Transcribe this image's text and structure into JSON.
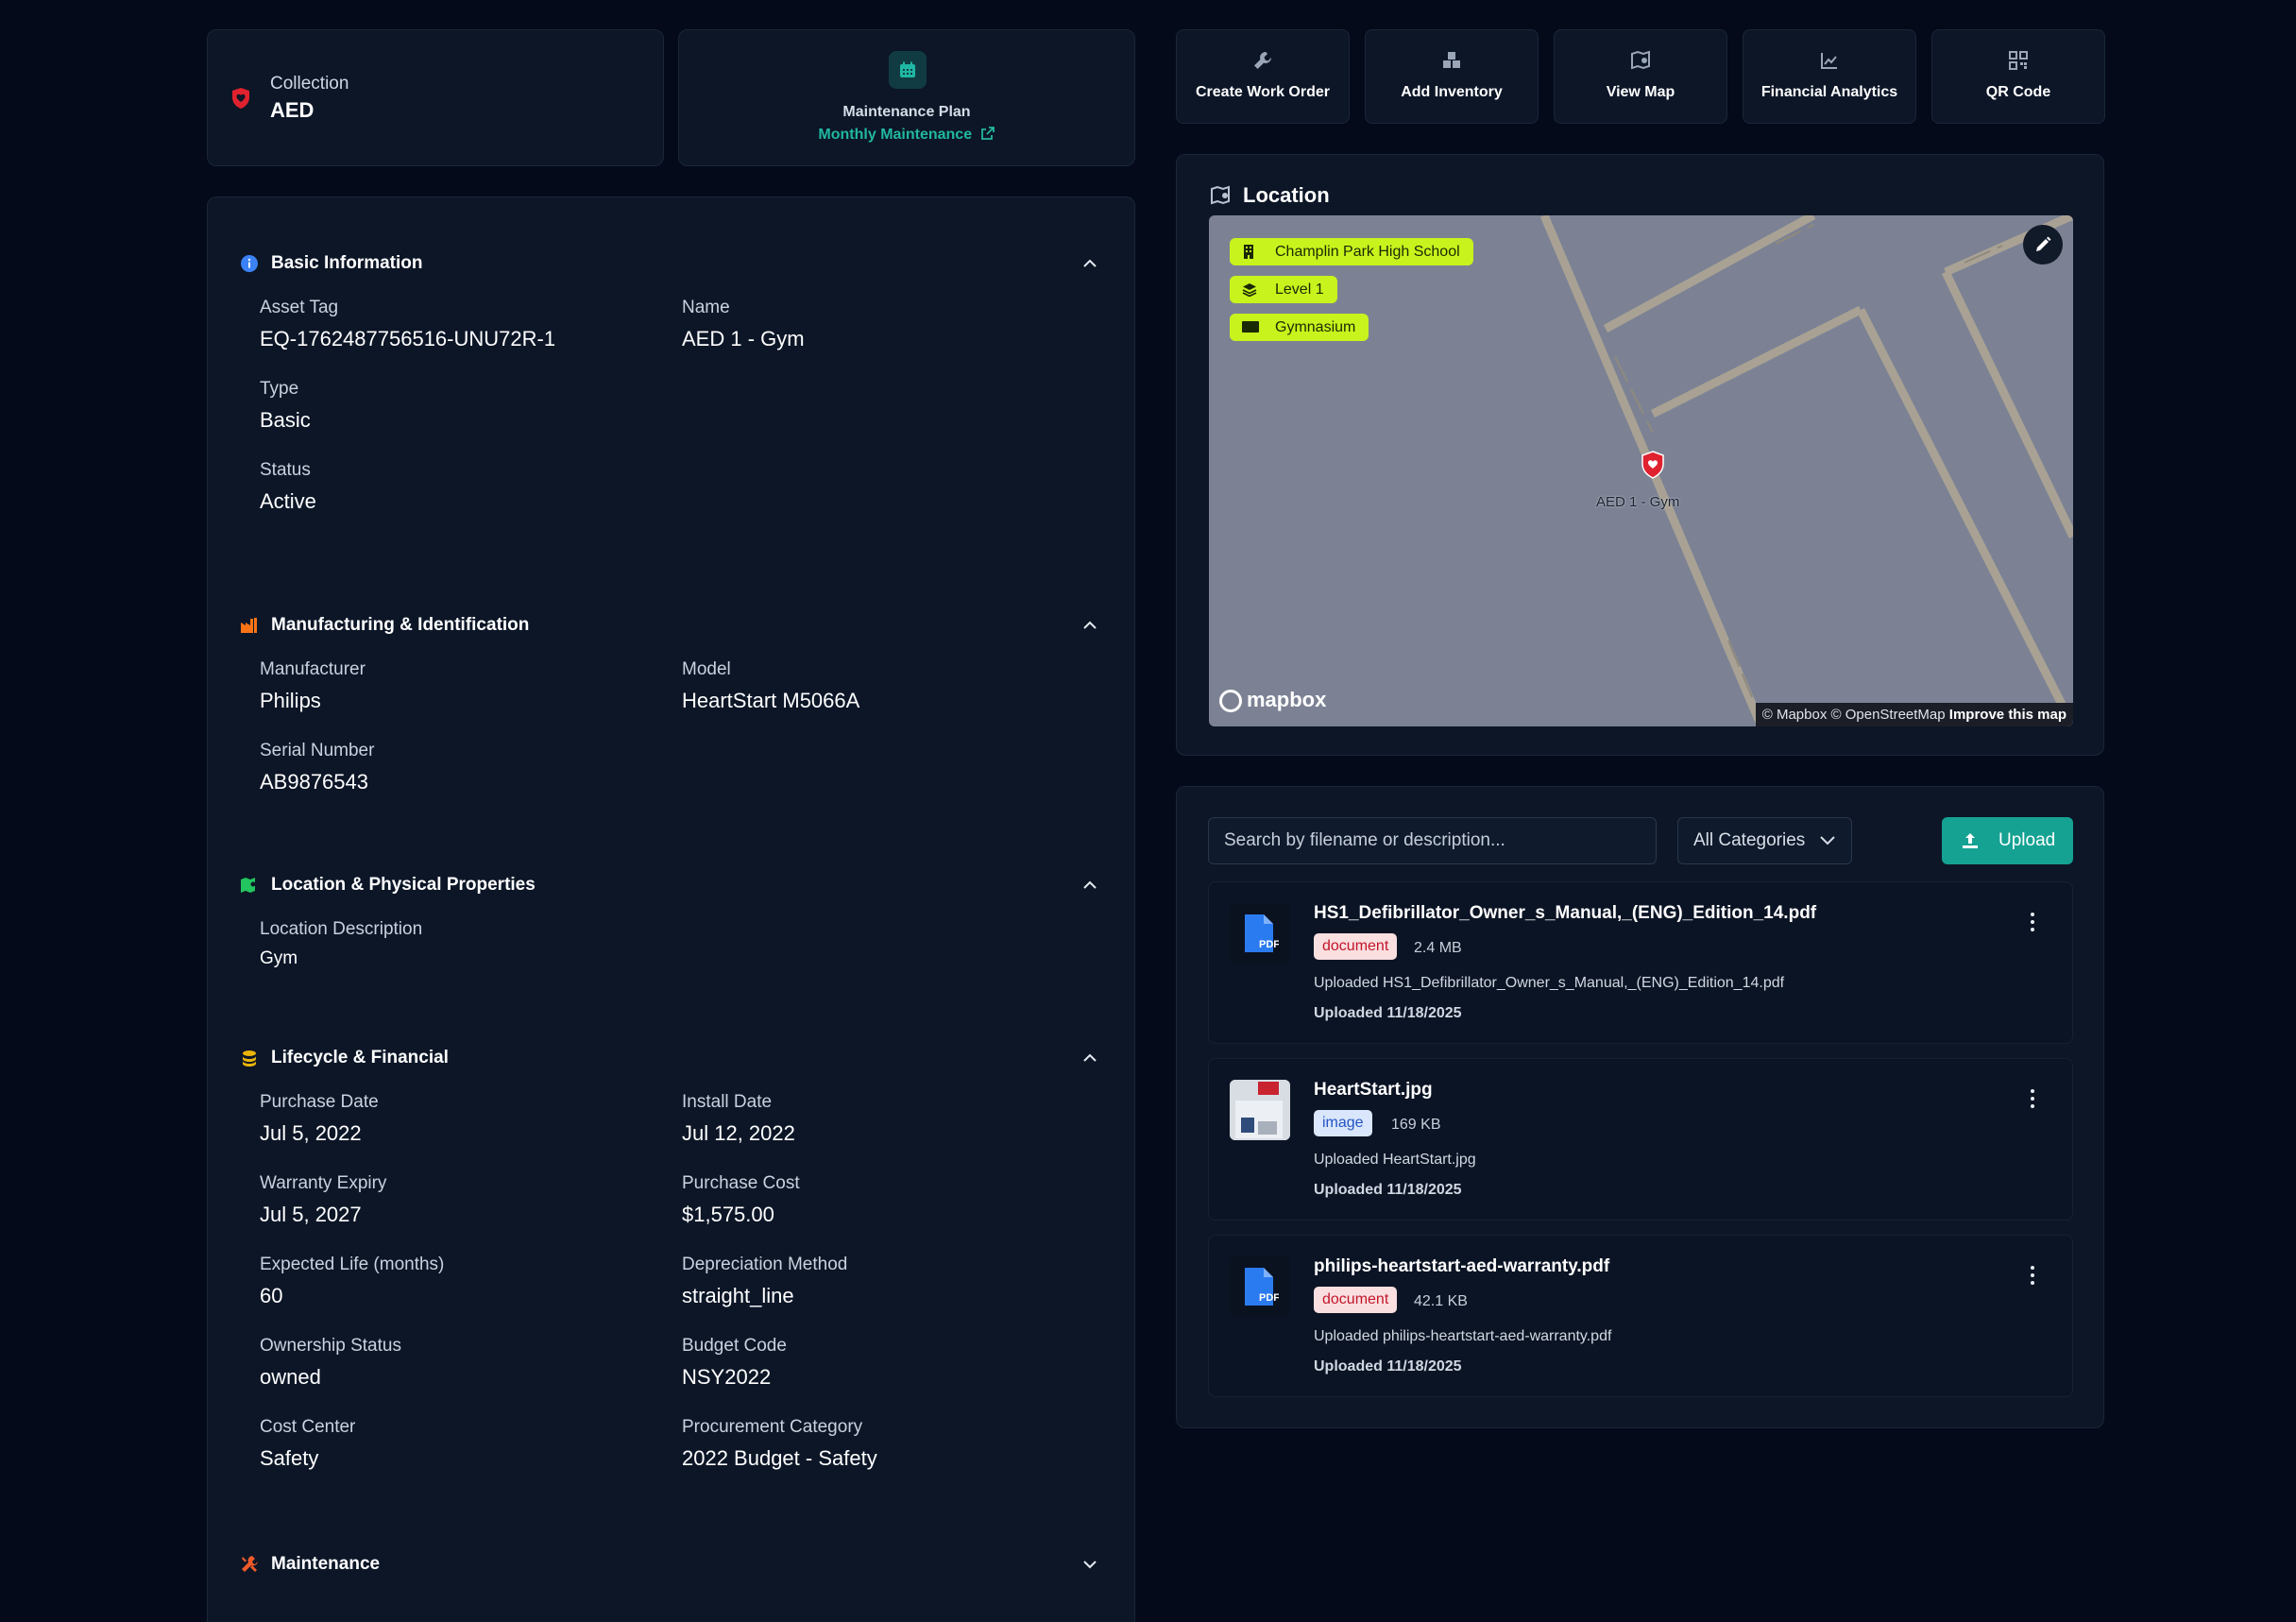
{
  "collection": {
    "label": "Collection",
    "value": "AED"
  },
  "maintenance_plan": {
    "title": "Maintenance Plan",
    "link": "Monthly Maintenance"
  },
  "actions": [
    {
      "label": "Create Work Order",
      "icon": "wrench-icon"
    },
    {
      "label": "Add Inventory",
      "icon": "boxes-icon"
    },
    {
      "label": "View Map",
      "icon": "map-pin-icon"
    },
    {
      "label": "Financial Analytics",
      "icon": "chart-line-icon"
    },
    {
      "label": "QR Code",
      "icon": "qr-code-icon"
    }
  ],
  "sections": {
    "basic": {
      "title": "Basic Information",
      "fields": [
        {
          "label": "Asset Tag",
          "value": "EQ-1762487756516-UNU72R-1"
        },
        {
          "label": "Name",
          "value": "AED 1 - Gym"
        },
        {
          "label": "Type",
          "value": "Basic"
        },
        {
          "label": "Status",
          "value": "Active"
        }
      ]
    },
    "manufacturing": {
      "title": "Manufacturing & Identification",
      "fields": [
        {
          "label": "Manufacturer",
          "value": "Philips"
        },
        {
          "label": "Model",
          "value": "HeartStart M5066A"
        },
        {
          "label": "Serial Number",
          "value": "AB9876543"
        }
      ]
    },
    "location": {
      "title": "Location & Physical Properties",
      "fields": [
        {
          "label": "Location Description",
          "value": "Gym"
        }
      ]
    },
    "lifecycle": {
      "title": "Lifecycle & Financial",
      "fields": [
        {
          "label": "Purchase Date",
          "value": "Jul 5, 2022"
        },
        {
          "label": "Install Date",
          "value": "Jul 12, 2022"
        },
        {
          "label": "Warranty Expiry",
          "value": "Jul 5, 2027"
        },
        {
          "label": "Purchase Cost",
          "value": "$1,575.00"
        },
        {
          "label": "Expected Life (months)",
          "value": "60"
        },
        {
          "label": "Depreciation Method",
          "value": "straight_line"
        },
        {
          "label": "Ownership Status",
          "value": "owned"
        },
        {
          "label": "Budget Code",
          "value": "NSY2022"
        },
        {
          "label": "Cost Center",
          "value": "Safety"
        },
        {
          "label": "Procurement Category",
          "value": "2022 Budget - Safety"
        }
      ]
    },
    "maintenance": {
      "title": "Maintenance"
    }
  },
  "location_card": {
    "title": "Location",
    "chips": [
      "Champlin Park High School",
      "Level 1",
      "Gymnasium"
    ],
    "pin_label": "AED 1 - Gym",
    "mapbox_logo": "mapbox",
    "attribution": "© Mapbox © OpenStreetMap",
    "improve_link": "Improve this map"
  },
  "files": {
    "search_placeholder": "Search by filename or description...",
    "category_selected": "All Categories",
    "upload_label": "Upload",
    "items": [
      {
        "name": "HS1_Defibrillator_Owner_s_Manual,_(ENG)_Edition_14.pdf",
        "badge": "document",
        "size": "2.4 MB",
        "description": "Uploaded HS1_Defibrillator_Owner_s_Manual,_(ENG)_Edition_14.pdf",
        "uploaded": "Uploaded 11/18/2025",
        "thumb": "pdf-file-icon"
      },
      {
        "name": "HeartStart.jpg",
        "badge": "image",
        "size": "169 KB",
        "description": "Uploaded HeartStart.jpg",
        "uploaded": "Uploaded 11/18/2025",
        "thumb": "image-thumbnail"
      },
      {
        "name": "philips-heartstart-aed-warranty.pdf",
        "badge": "document",
        "size": "42.1 KB",
        "description": "Uploaded philips-heartstart-aed-warranty.pdf",
        "uploaded": "Uploaded 11/18/2025",
        "thumb": "pdf-file-icon"
      }
    ]
  },
  "colors": {
    "accent_teal": "#15a292",
    "chip_lime": "#c9f31c",
    "danger_red": "#e0222f",
    "background": "#040a19",
    "card": "#0c1627"
  }
}
